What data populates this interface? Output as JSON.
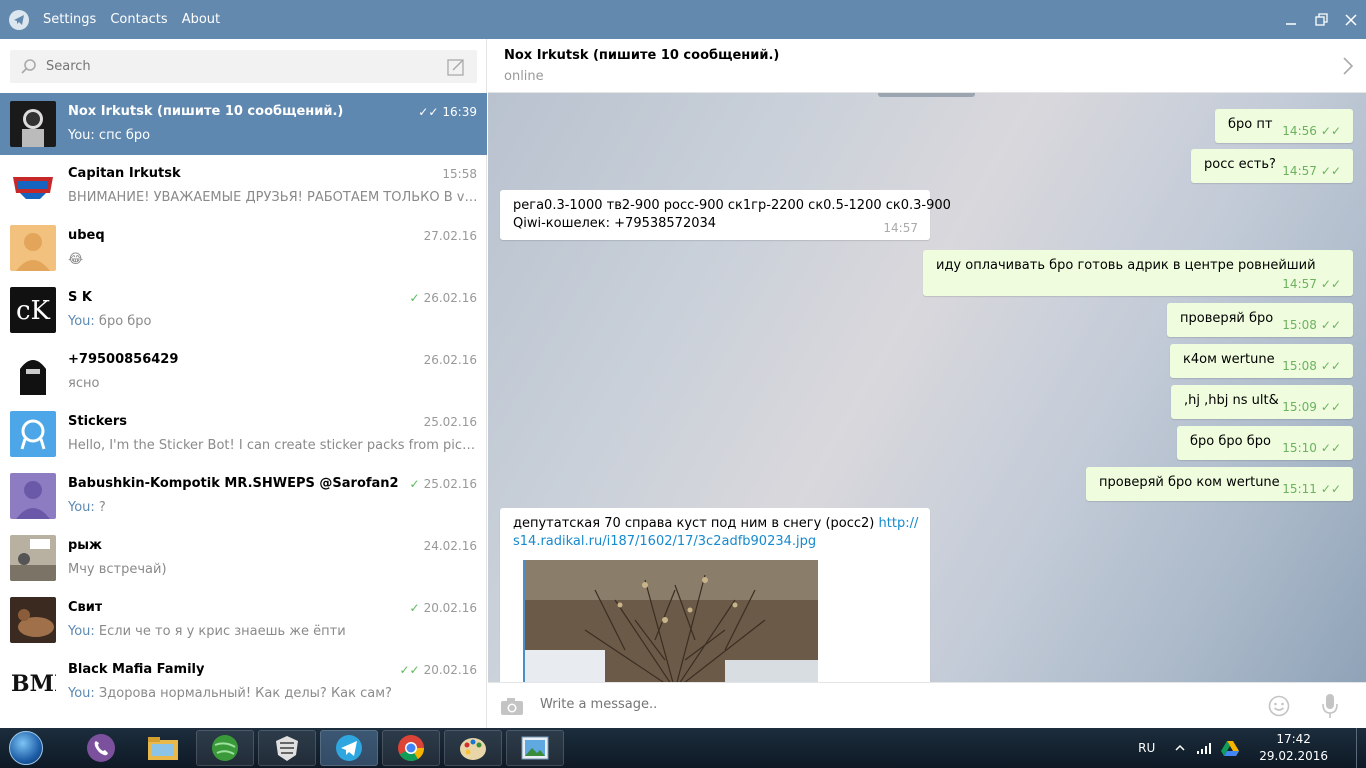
{
  "titlebar": {
    "menu": [
      "Settings",
      "Contacts",
      "About"
    ]
  },
  "search": {
    "placeholder": "Search"
  },
  "dialogs": [
    {
      "name": "Nox Irkutsk (пишите 10 сообщений.)",
      "date": "16:39",
      "you": "You:",
      "text": " спс бро",
      "checks": "double",
      "active": true
    },
    {
      "name": "Capitan Irkutsk",
      "date": "15:58",
      "you": "",
      "text": "ВНИМАНИЕ! УВАЖАЕМЫЕ ДРУЗЬЯ! РАБОТАЕМ ТОЛЬКО В vipole! ...",
      "checks": "none"
    },
    {
      "name": "ubeq",
      "date": "27.02.16",
      "you": "",
      "text": "😂",
      "checks": "none"
    },
    {
      "name": "S K",
      "date": "26.02.16",
      "you": "You:",
      "text": " бро бро",
      "checks": "single"
    },
    {
      "name": "+79500856429",
      "date": "26.02.16",
      "you": "",
      "text": "ясно",
      "checks": "none"
    },
    {
      "name": "Stickers",
      "date": "25.02.16",
      "you": "",
      "text": "Hello, I'm the Sticker Bot! I can create sticker packs from pictures an...",
      "checks": "none"
    },
    {
      "name": "Babushkin-Kompotik MR.SHWEPS @Sarofan2",
      "date": "25.02.16",
      "you": "You:",
      "text": " ?",
      "checks": "single"
    },
    {
      "name": "рыж",
      "date": "24.02.16",
      "you": "",
      "text": "Мчу встречай)",
      "checks": "none"
    },
    {
      "name": "Свит",
      "date": "20.02.16",
      "you": "You:",
      "text": " Если че то я у крис знаешь же ёпти",
      "checks": "single"
    },
    {
      "name": "Black Mafia Family",
      "date": "20.02.16",
      "you": "You:",
      "text": " Здорова нормальный! Как делы? Как сам?",
      "checks": "double"
    }
  ],
  "chat": {
    "title": "Nox Irkutsk (пишите 10 сообщений.)",
    "status": "online",
    "messages": [
      {
        "dir": "out",
        "text": "бро пт",
        "time": "14:56"
      },
      {
        "dir": "out",
        "text": "росс есть?",
        "time": "14:57"
      },
      {
        "dir": "in",
        "line1": "рега0.3-1000 тв2-900 росс-900 ск1гр-2200 ск0.5-1200 ск0.3-900",
        "line2": "Qiwi-кошелек: +79538572034",
        "time": "14:57"
      },
      {
        "dir": "out",
        "text": "иду оплачивать бро готовь адрик в центре ровнейший",
        "time": "14:57"
      },
      {
        "dir": "out",
        "text": "проверяй бро",
        "time": "15:08"
      },
      {
        "dir": "out",
        "text": "к4ом wertune",
        "time": "15:08"
      },
      {
        "dir": "out",
        "text": ",hj ,hbj ns ult&",
        "time": "15:09"
      },
      {
        "dir": "out",
        "text": "бро бро бро",
        "time": "15:10"
      },
      {
        "dir": "out",
        "text": "проверяй бро ком wertune",
        "time": "15:11"
      },
      {
        "dir": "in",
        "line1": "депутатская 70 справа куст под ним в снегу (росс2) ",
        "link1": "http://",
        "link2": "s14.radikal.ru/i187/1602/17/3c2adfb90234.jpg"
      }
    ]
  },
  "composer": {
    "placeholder": "Write a message.."
  },
  "taskbar": {
    "lang": "RU",
    "time": "17:42",
    "date": "29.02.2016"
  },
  "colors": {
    "titlebar": "#6389ae",
    "active_dialog": "#5f88b1",
    "out_bubble": "#effdde",
    "check_green": "#5cb85c",
    "link": "#168acd"
  }
}
